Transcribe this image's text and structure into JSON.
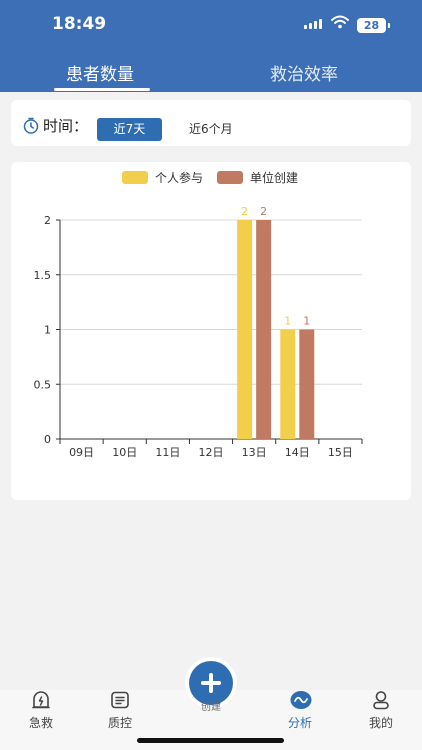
{
  "status": {
    "time": "18:49",
    "battery": "28"
  },
  "tabs": [
    {
      "label": "患者数量",
      "active": true
    },
    {
      "label": "救治效率",
      "active": false
    }
  ],
  "filter": {
    "label": "时间：",
    "options": [
      {
        "label": "近7天",
        "selected": true
      },
      {
        "label": "近6个月",
        "selected": false
      }
    ]
  },
  "chart_data": {
    "type": "bar",
    "categories": [
      "09日",
      "10日",
      "11日",
      "12日",
      "13日",
      "14日",
      "15日"
    ],
    "series": [
      {
        "name": "个人参与",
        "color": "#f2cf4a",
        "values": [
          0,
          0,
          0,
          0,
          2,
          1,
          0
        ]
      },
      {
        "name": "单位创建",
        "color": "#c07a62",
        "values": [
          0,
          0,
          0,
          0,
          2,
          1,
          0
        ]
      }
    ],
    "yticks": [
      "0",
      "0.5",
      "1",
      "1.5",
      "2"
    ],
    "ylim": [
      0,
      2
    ],
    "grid": true,
    "legend": "top-center",
    "data_labels": true
  },
  "tabbar": {
    "items": [
      {
        "label": "急救",
        "icon": "first-aid-icon",
        "active": false
      },
      {
        "label": "质控",
        "icon": "clipboard-icon",
        "active": false
      },
      {
        "label": "分析",
        "icon": "analytics-icon",
        "active": true
      },
      {
        "label": "我的",
        "icon": "profile-icon",
        "active": false
      }
    ],
    "fab_label": "创建"
  }
}
